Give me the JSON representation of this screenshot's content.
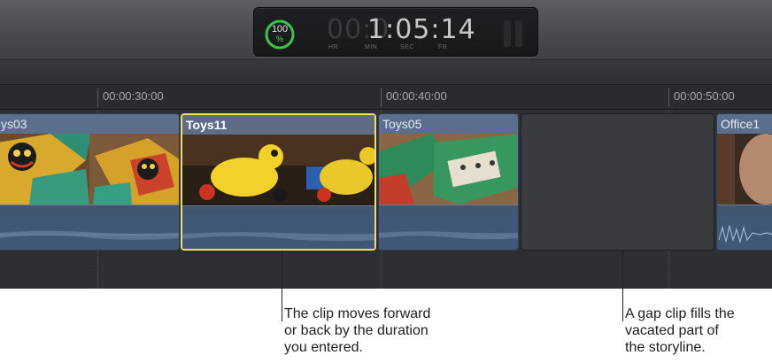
{
  "dashboard": {
    "progress_percent": 100,
    "progress_value": "100",
    "progress_unit": "%",
    "timecode_inactive": "00:0",
    "timecode_active": "1:05:14",
    "units": [
      "HR",
      "MIN",
      "SEC",
      "FR"
    ]
  },
  "ruler": {
    "times": [
      "00:00:30:00",
      "00:00:40:00",
      "00:00:50:00"
    ]
  },
  "clips": [
    {
      "name": "ys03"
    },
    {
      "name": "Toys11"
    },
    {
      "name": "Toys05"
    },
    {
      "name": "Office1"
    }
  ],
  "callouts": [
    {
      "lines": [
        "The clip moves forward",
        "or back by the duration",
        "you entered."
      ]
    },
    {
      "lines": [
        "A gap clip fills the",
        "vacated part of",
        "the storyline."
      ]
    }
  ],
  "colors": {
    "selection": "#f1e05c",
    "clip_blue": "#4a5f7c",
    "gauge_green": "#3fc24a"
  }
}
